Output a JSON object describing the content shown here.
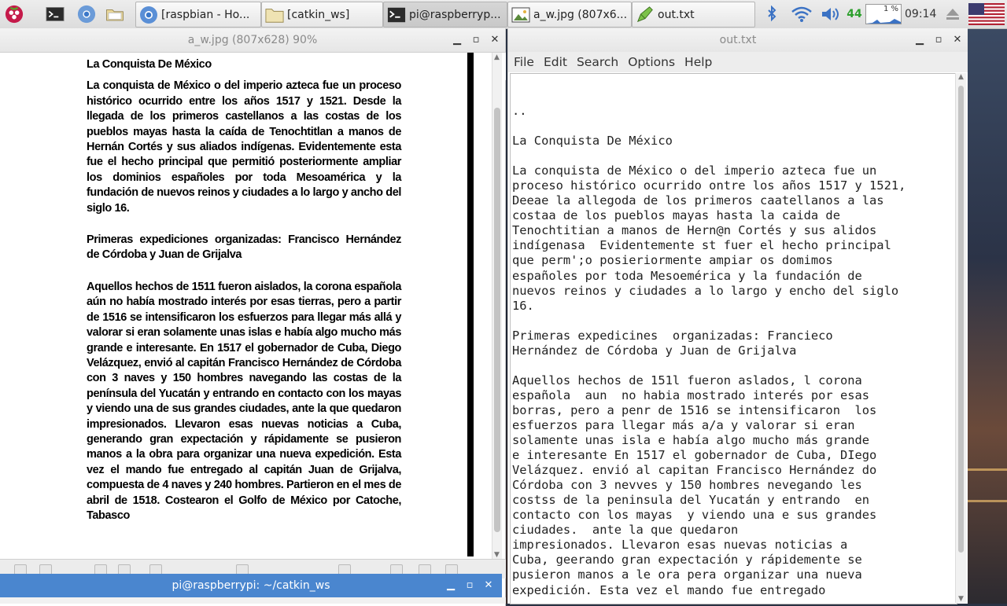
{
  "taskbar": {
    "tasks": [
      {
        "label": "[raspbian - Ho...",
        "icon": "chromium-icon"
      },
      {
        "label": "[catkin_ws]",
        "icon": "folder-icon"
      },
      {
        "label": "pi@raspberryp...",
        "icon": "terminal-icon"
      },
      {
        "label": "a_w.jpg (807x6...",
        "icon": "image-viewer-icon"
      },
      {
        "label": "out.txt",
        "icon": "text-editor-icon"
      }
    ],
    "tray": {
      "temperature": "44",
      "cpu": "1 %",
      "clock": "09:14"
    }
  },
  "image_viewer": {
    "title": "a_w.jpg (807x628) 90%",
    "doc_title": "La Conquista De México",
    "doc_paragraphs": [
      "La conquista de México o del imperio azteca fue un proceso histórico ocurrido entre los años 1517 y 1521. Desde la llegada de los primeros castellanos a las costas de los pueblos mayas hasta la caída de Tenochtitlan a manos de Hernán Cortés y sus aliados indígenas. Evidentemente esta fue el hecho principal que permitió posteriormente ampliar los dominios españoles por toda Mesoamérica y la fundación de nuevos reinos y ciudades a lo largo y ancho del siglo 16.",
      "Primeras expediciones organizadas: Francisco Hernández de Córdoba y Juan de Grijalva",
      "Aquellos hechos de 1511 fueron aislados, la corona española aún no había mostrado interés por esas tierras, pero a partir de 1516 se intensificaron los esfuerzos para llegar más allá y valorar si eran solamente unas islas e había algo mucho más grande e interesante. En 1517 el gobernador de Cuba, Diego Velázquez, envió al capitán Francisco Hernández de Córdoba con 3 naves y 150 hombres navegando las costas de la península del Yucatán y entrando en contacto con los mayas y viendo una de sus grandes ciudades, ante la que quedaron impresionados. Llevaron esas nuevas noticias a Cuba, generando gran expectación y rápidamente se pusieron manos a la obra para organizar una nueva expedición. Esta vez el mando fue entregado al capitán Juan de Grijalva, compuesta de 4 naves y 240 hombres. Partieron en el mes de abril de 1518. Costearon el Golfo de México por Catoche, Tabasco"
    ]
  },
  "terminal_bar": {
    "title": "pi@raspberrypi: ~/catkin_ws"
  },
  "text_editor": {
    "title": "out.txt",
    "menu": [
      "File",
      "Edit",
      "Search",
      "Options",
      "Help"
    ],
    "content": "..\n\nLa Conquista De México\n\nLa conquista de México o del imperio azteca fue un\nproceso histórico ocurrido ontre los años 1517 y 1521,\nDeeae la allegoda de los primeros caatellanos a las\ncostaa de los pueblos mayas hasta la caida de\nTenochtitian a manos de Hern@n Cortés y sus alidos\nindígenasa  Evidentemente st fuer el hecho principal\nque perm';o posieriormente ampiar os domimos\nespañoles por toda Mesoemérica y la fundación de\nnuevos reinos y ciudades a lo largo y encho del siglo\n16.\n\nPrimeras expedicines  organizadas: Francieco\nHernández de Córdoba y Juan de Grijalva\n\nAquellos hechos de 151l fueron aslados, l corona\nespañola  aun  no habia mostrado interés por esas\nborras, pero a penr de 1516 se intensificaron  los\nesfuerzos para llegar más a/a y valorar si eran\nsolamente unas isla e había algo mucho más grande\ne interesante En 1517 el gobernador de Cuba, DIego\nVelázquez. envió al capitan Francisco Hernández do\nCórdoba con 3 nevves y 150 hombres nevegando les\ncostss de la peninsula del Yucatán y entrando  en\ncontacto con los mayas  y viendo una e sus grandes\nciudades.  ante la que quedaron\nimpresionados. Llevaron esas nuevas noticias a\nCuba, geerando gran expectación y rápidemente se\npusieron manos a le ora pera organizar una nueva\nexpedición. Esta vez el mando fue entregado"
  }
}
